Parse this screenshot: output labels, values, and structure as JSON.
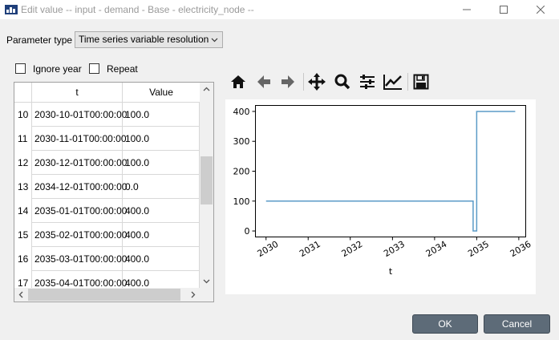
{
  "window": {
    "title": "Edit value   -- input - demand - Base - electricity_node --",
    "icon": "app-icon",
    "controls": [
      "minimize-icon",
      "maximize-icon",
      "close-icon"
    ]
  },
  "parameter_type": {
    "label": "Parameter type",
    "selected": "Time series variable resolution"
  },
  "options": {
    "ignore_year": {
      "label": "Ignore year",
      "checked": false
    },
    "repeat": {
      "label": "Repeat",
      "checked": false
    }
  },
  "table": {
    "headers": {
      "t": "t",
      "value": "Value"
    },
    "rows": [
      {
        "index": "10",
        "t": "2030-10-01T00:00:00",
        "value": "100.0"
      },
      {
        "index": "11",
        "t": "2030-11-01T00:00:00",
        "value": "100.0"
      },
      {
        "index": "12",
        "t": "2030-12-01T00:00:00",
        "value": "100.0"
      },
      {
        "index": "13",
        "t": "2034-12-01T00:00:00",
        "value": "0.0"
      },
      {
        "index": "14",
        "t": "2035-01-01T00:00:00",
        "value": "400.0"
      },
      {
        "index": "15",
        "t": "2035-02-01T00:00:00",
        "value": "400.0"
      },
      {
        "index": "16",
        "t": "2035-03-01T00:00:00",
        "value": "400.0"
      },
      {
        "index": "17",
        "t": "2035-04-01T00:00:00",
        "value": "400.0"
      }
    ]
  },
  "toolbar": {
    "buttons": [
      "home-icon",
      "back-icon",
      "forward-icon",
      "pan-icon",
      "zoom-icon",
      "configure-subplots-icon",
      "edit-axis-icon",
      "save-icon"
    ]
  },
  "buttons": {
    "ok": "OK",
    "cancel": "Cancel"
  },
  "colors": {
    "line": "#5b9bc7",
    "button": "#5d6b78"
  },
  "chart_data": {
    "type": "line",
    "drawstyle": "steps-post",
    "xlabel": "t",
    "ylabel": "",
    "x_ticks": [
      "2030",
      "2031",
      "2032",
      "2033",
      "2034",
      "2035",
      "2036"
    ],
    "y_ticks": [
      "0",
      "100",
      "200",
      "300",
      "400"
    ],
    "xlim": [
      "2029-10-01",
      "2036-03-01"
    ],
    "ylim": [
      -20,
      420
    ],
    "series": [
      {
        "x": [
          "2030-01-01",
          "2034-12-01",
          "2035-01-01",
          "2035-12-01"
        ],
        "y": [
          100,
          0,
          400,
          400
        ]
      }
    ]
  }
}
